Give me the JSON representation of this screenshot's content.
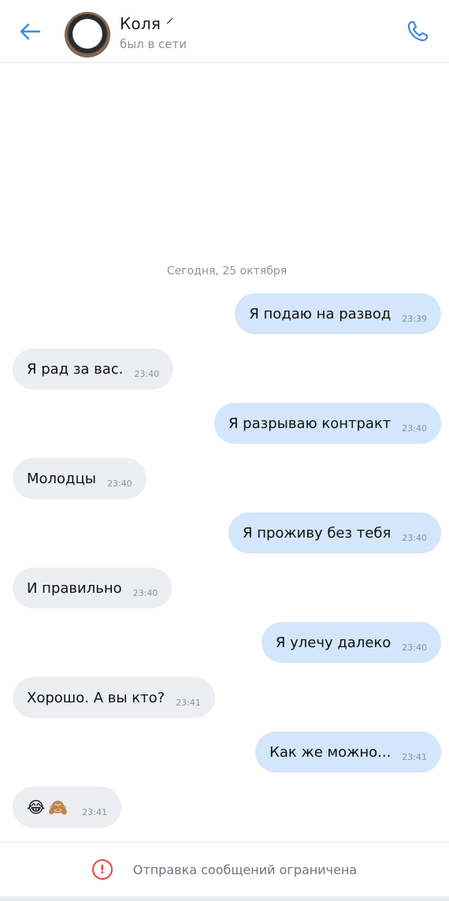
{
  "header": {
    "back_icon": "arrow-left-icon",
    "contact_name": "Коля ⸍",
    "status": "был в сети",
    "call_icon": "phone-icon",
    "accent_color": "#3f8ae0"
  },
  "chat": {
    "date_label": "Сегодня, 25 октября",
    "messages": [
      {
        "direction": "out",
        "text": "Я подаю на развод",
        "time": "23:39"
      },
      {
        "direction": "in",
        "text": "Я рад за вас.",
        "time": "23:40"
      },
      {
        "direction": "out",
        "text": "Я разрываю контракт",
        "time": "23:40"
      },
      {
        "direction": "in",
        "text": "Молодцы",
        "time": "23:40"
      },
      {
        "direction": "out",
        "text": "Я проживу без тебя",
        "time": "23:40"
      },
      {
        "direction": "in",
        "text": "И правильно",
        "time": "23:40"
      },
      {
        "direction": "out",
        "text": "Я улечу далеко",
        "time": "23:40"
      },
      {
        "direction": "in",
        "text": "Хорошо. А вы кто?",
        "time": "23:41"
      },
      {
        "direction": "out",
        "text": "Как же можно...",
        "time": "23:41"
      },
      {
        "direction": "in",
        "text": "😂🙈",
        "time": "23:41"
      }
    ]
  },
  "footer": {
    "warning_icon": "exclamation-circle-icon",
    "warning_color": "#e64646",
    "text": "Отправка сообщений ограничена"
  }
}
